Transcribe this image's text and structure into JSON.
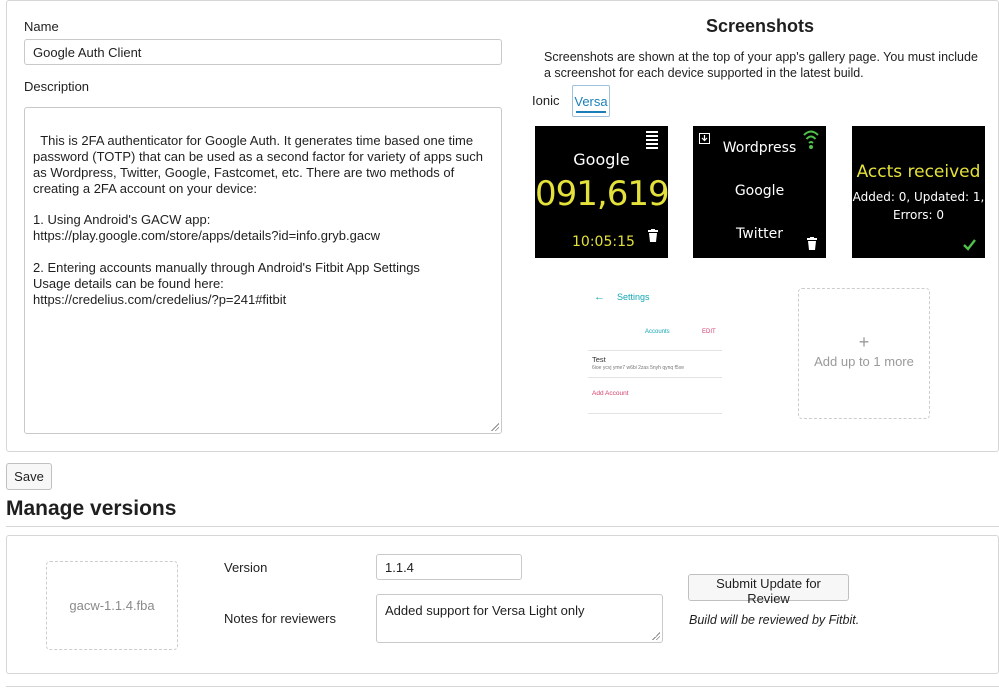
{
  "app": {
    "name_label": "Name",
    "name_value": "Google Auth Client",
    "description_label": "Description",
    "description_value": "This is 2FA authenticator for Google Auth. It generates time based one time password (TOTP) that can be used as a second factor for variety of apps such as Wordpress, Twitter, Google, Fastcomet, etc. There are two methods of creating a 2FA account on your device:\n\n1. Using Android's GACW app:\nhttps://play.google.com/store/apps/details?id=info.gryb.gacw\n\n2. Entering accounts manually through Android's Fitbit App Settings\nUsage details can be found here:\nhttps://credelius.com/credelius/?p=241#fitbit"
  },
  "screenshots": {
    "title": "Screenshots",
    "help": "Screenshots are shown at the top of your app's gallery page. You must include a screenshot for each device supported in the latest build.",
    "tabs": [
      {
        "label": "Ionic",
        "selected": false
      },
      {
        "label": "Versa",
        "selected": true
      }
    ],
    "shot1": {
      "name": "Google",
      "code": "091,619",
      "time": "10:05:15",
      "icons": [
        "menu-icon",
        "trash-icon"
      ]
    },
    "shot2": {
      "items": [
        "Wordpress",
        "Google",
        "Twitter"
      ],
      "icons": [
        "download-icon",
        "wifi-icon",
        "trash-icon"
      ]
    },
    "shot3": {
      "title": "Accts received",
      "line1": "Added: 0, Updated: 1,",
      "line2": "Errors: 0",
      "icons": [
        "check-icon"
      ]
    },
    "shot4": {
      "back_arrow": "←",
      "header": "Settings",
      "tab_accounts": "Accounts",
      "tab_edit": "EDIT",
      "entry_name": "Test",
      "entry_secret": "6ioe ycvj yme7 w6bi 2zas 5nyh qynq f5xe",
      "add_account": "Add Account"
    },
    "add_more_label": "Add up to 1 more",
    "add_more_plus": "+"
  },
  "colors": {
    "accent": "#1a7fb9",
    "watch_yellow": "#e4e23a",
    "watch_green": "#4fc24a",
    "settings_teal": "#13a7b3",
    "settings_pink": "#d2426d"
  },
  "toolbar": {
    "save_label": "Save"
  },
  "versions": {
    "section_title": "Manage versions",
    "build_file": "gacw-1.1.4.fba",
    "version_label": "Version",
    "version_value": "1.1.4",
    "notes_label": "Notes for reviewers",
    "notes_value": "Added support for Versa Light only",
    "submit_label": "Submit Update for Review",
    "review_note": "Build will be reviewed by Fitbit."
  }
}
